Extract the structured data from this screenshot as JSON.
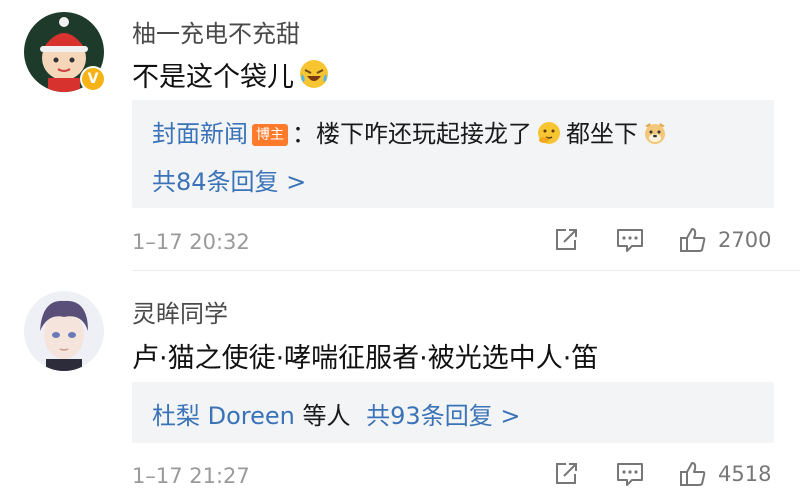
{
  "comments": [
    {
      "username": "柚一充电不充甜",
      "content": "不是这个袋儿",
      "content_emoji": "laugh-cry-emoji",
      "reply": {
        "author": "封面新闻",
        "author_tag": "博主",
        "separator": "：",
        "text_part1": "楼下咋还玩起接龙了",
        "emoji1": "thinking-face-emoji",
        "text_part2": "都坐下",
        "emoji2": "dog-face-emoji",
        "more": "共84条回复 >"
      },
      "timestamp": "1–17 20:32",
      "likes": "2700"
    },
    {
      "username": "灵眸同学",
      "content": "卢·猫之使徒·哮喘征服者·被光选中人·笛",
      "reply": {
        "names": "杜梨 Doreen",
        "names_suffix": "等人",
        "more": "共93条回复 >"
      },
      "timestamp": "1–17 21:27",
      "likes": "4518"
    }
  ],
  "colors": {
    "link": "#3a73b8",
    "reply_bg": "#f3f4f6",
    "meta": "#9a9a9a",
    "badge": "#f6b317",
    "tag": "#ff7a2a"
  }
}
